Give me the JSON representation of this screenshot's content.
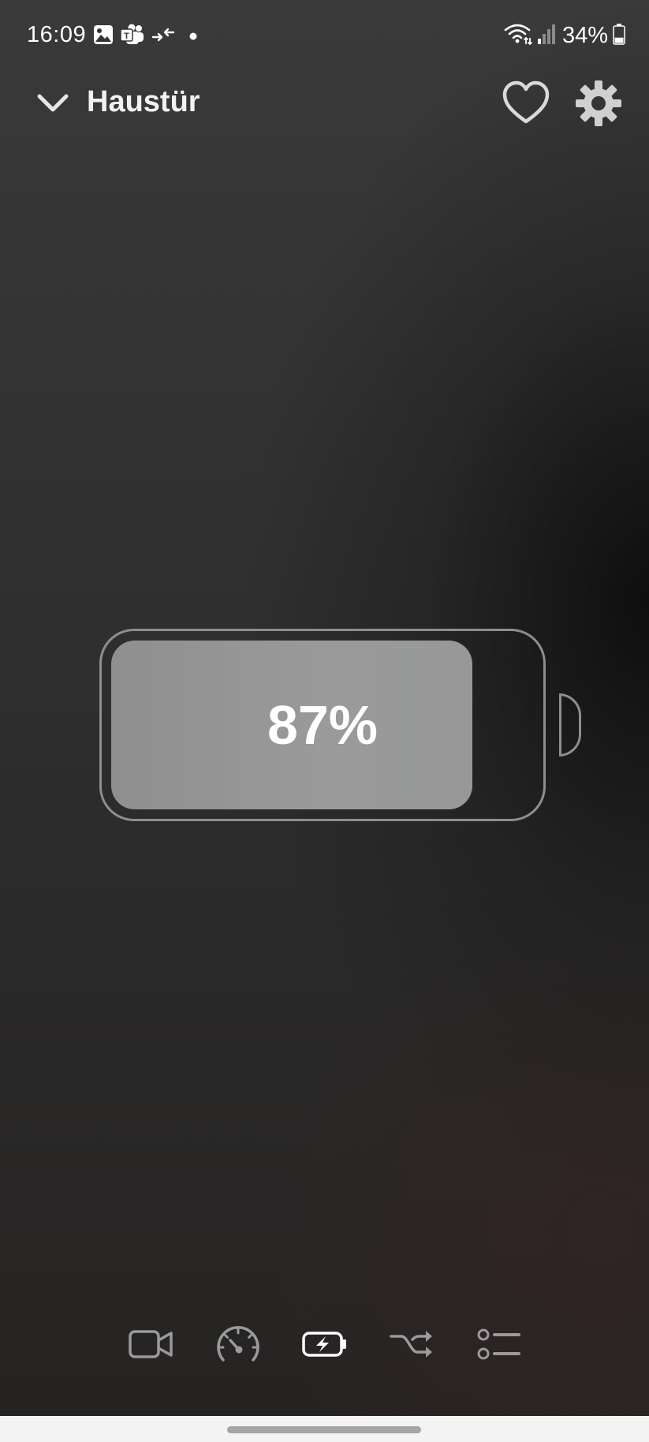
{
  "status_bar": {
    "time": "16:09",
    "battery_text": "34%",
    "battery_level": 0.34,
    "icons_left": [
      "gallery-icon",
      "teams-icon",
      "data-transfer-icon",
      "notification-dot-icon"
    ],
    "icons_right": [
      "wifi-icon",
      "signal-icon",
      "phone-battery-icon"
    ]
  },
  "header": {
    "title": "Haustür",
    "back_icon": "chevron-down-icon",
    "favorite_icon": "heart-icon",
    "settings_icon": "gear-icon"
  },
  "battery": {
    "percent_label": "87%",
    "level": 0.87,
    "fill_color": "#969696",
    "outline_color": "#8e8e8e"
  },
  "bottom_nav": {
    "items": [
      {
        "icon": "video-camera-icon",
        "active": false
      },
      {
        "icon": "speedometer-icon",
        "active": false
      },
      {
        "icon": "battery-charging-icon",
        "active": true
      },
      {
        "icon": "shuffle-icon",
        "active": false
      },
      {
        "icon": "list-settings-icon",
        "active": false
      }
    ],
    "active_color": "#ffffff",
    "inactive_color": "#9a9a9a"
  }
}
